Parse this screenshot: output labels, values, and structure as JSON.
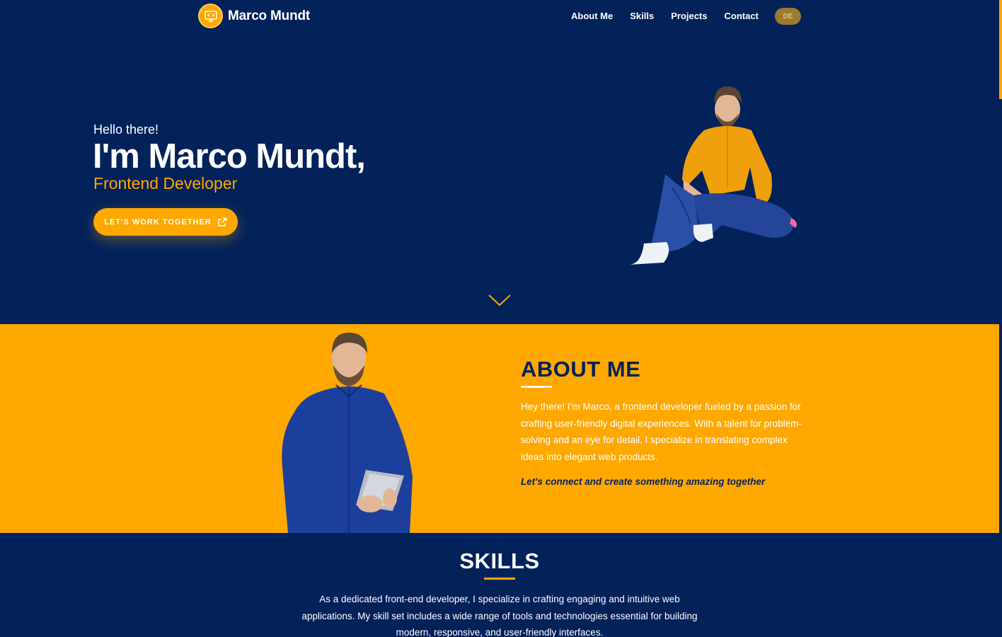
{
  "header": {
    "brand_name": "Marco Mundt",
    "nav": [
      "About Me",
      "Skills",
      "Projects",
      "Contact"
    ],
    "language_button": "DE"
  },
  "hero": {
    "greeting": "Hello there!",
    "name": "I'm Marco Mundt,",
    "role": "Frontend Developer",
    "cta_label": "LET'S WORK TOGETHER"
  },
  "about": {
    "title": "ABOUT ME",
    "text": "Hey there! I'm Marco, a frontend developer fueled by a passion for crafting user-friendly digital experiences. With a talent for problem-solving and an eye for detail, I specialize in translating complex ideas into elegant web products.",
    "tagline": "Let's connect and create something amazing together"
  },
  "skills": {
    "title": "SKILLS",
    "text": "As a dedicated front-end developer, I specialize in crafting engaging and intuitive web applications. My skill set includes a wide range of tools and technologies essential for building modern, responsive, and user-friendly interfaces."
  },
  "colors": {
    "navy": "#03225a",
    "accent": "#ffa800",
    "white": "#ffffff"
  },
  "icons": {
    "logo": "monitor-code-icon",
    "cta": "external-link-icon",
    "scroll": "chevron-down-icon"
  }
}
